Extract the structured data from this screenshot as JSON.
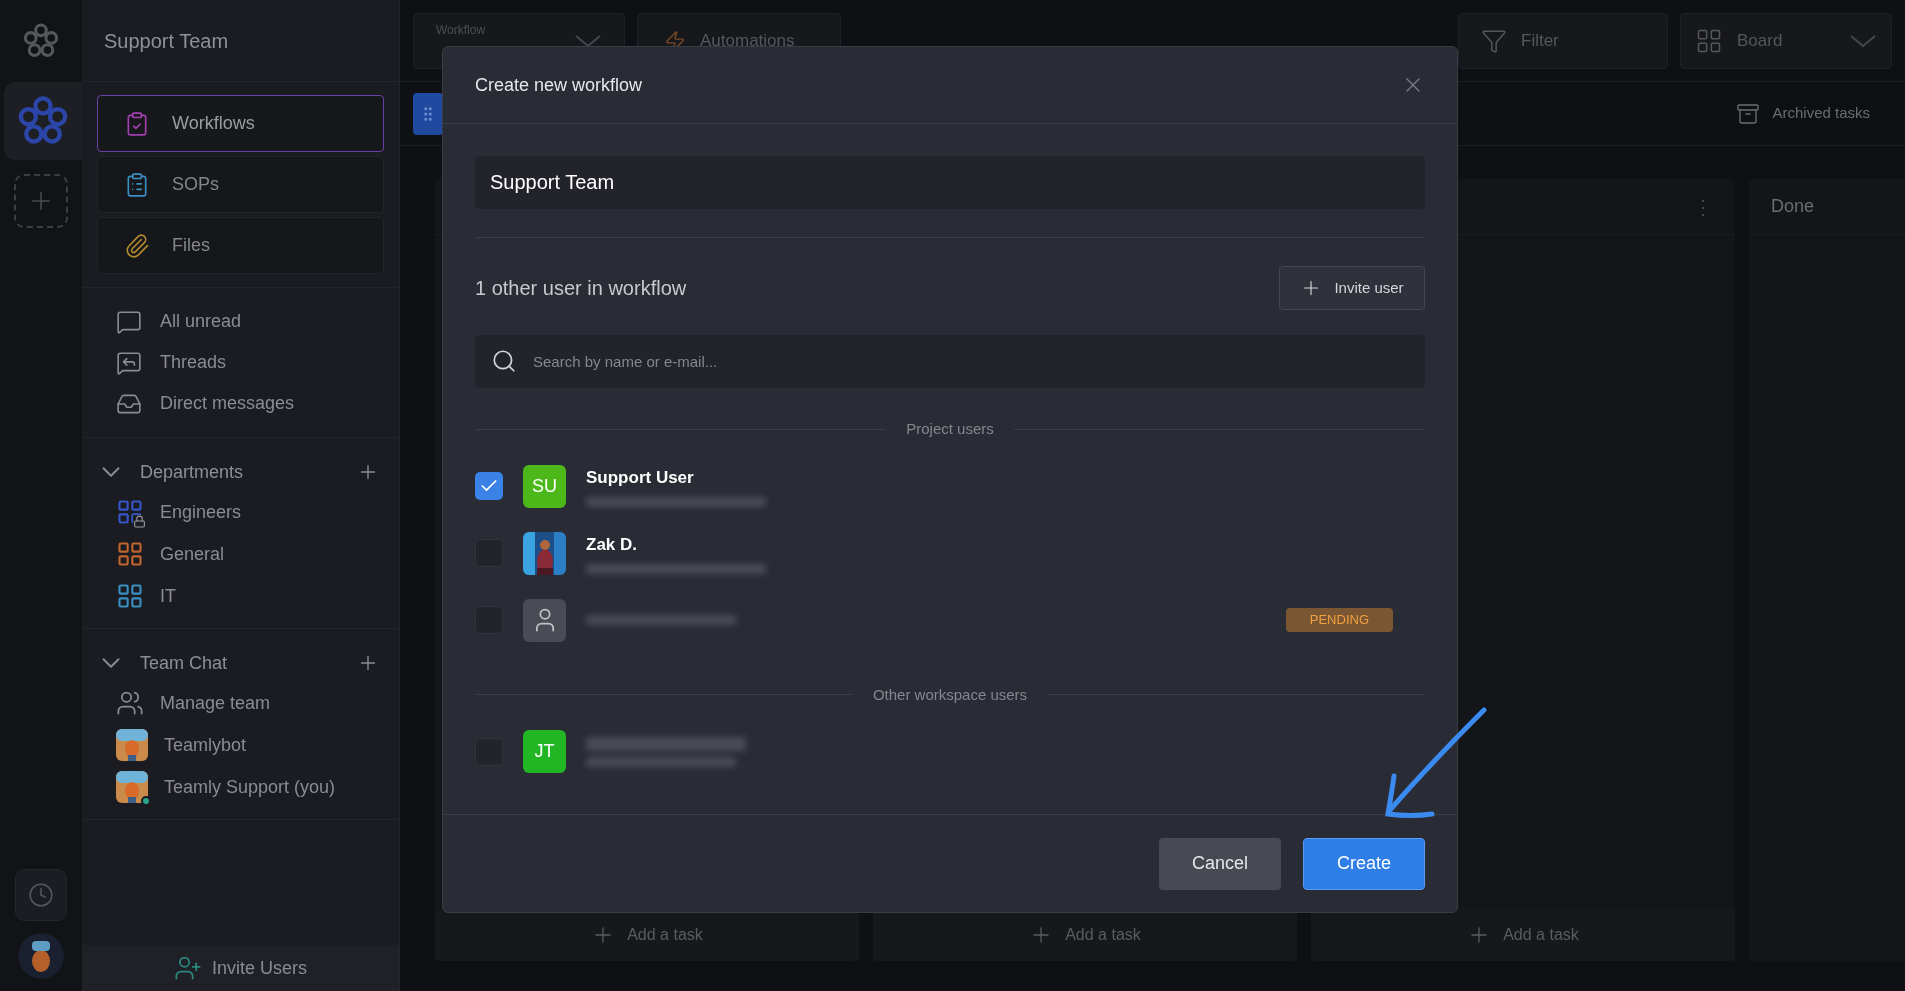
{
  "sidebar": {
    "title": "Support Team",
    "nav": [
      {
        "label": "Workflows",
        "selected": true
      },
      {
        "label": "SOPs",
        "selected": false
      },
      {
        "label": "Files",
        "selected": false
      }
    ],
    "links": [
      "All unread",
      "Threads",
      "Direct messages"
    ],
    "sections": [
      {
        "title": "Departments",
        "expanded": true,
        "items": [
          {
            "label": "Engineers",
            "color": "#3557c9",
            "locked": true
          },
          {
            "label": "General",
            "color": "#c2652f",
            "locked": false
          },
          {
            "label": "IT",
            "color": "#3a8fc4",
            "locked": false
          }
        ]
      },
      {
        "title": "Team Chat",
        "expanded": true,
        "items": [
          {
            "label": "Manage team",
            "kind": "action"
          },
          {
            "label": "Teamlybot",
            "kind": "bot"
          },
          {
            "label": "Teamly Support (you)",
            "kind": "user",
            "online": true
          }
        ]
      }
    ],
    "footer_button": "Invite Users"
  },
  "toolbar": {
    "workflow_select": {
      "label": "Workflow"
    },
    "automations": "Automations",
    "filter": "Filter",
    "view_select": "Board",
    "archived": "Archived tasks"
  },
  "columns": [
    {
      "add_label": "Add a task"
    },
    {
      "add_label": "Add a task"
    },
    {
      "menu": "⋮",
      "add_label": "Add a task"
    },
    {
      "title": "Done"
    }
  ],
  "modal": {
    "title": "Create new workflow",
    "name_value": "Support Team",
    "count_text": "1 other user in workflow",
    "invite_button": "Invite user",
    "search_placeholder": "Search by name or e-mail...",
    "groups": [
      {
        "title": "Project users",
        "users": [
          {
            "kind": "initials",
            "initials": "SU",
            "color": "#4cb81a",
            "name": "Support User",
            "checked": true
          },
          {
            "name": "Zak D.",
            "checked": false
          },
          {
            "kind": "placeholder",
            "checked": false,
            "badge": "PENDING"
          }
        ]
      },
      {
        "title": "Other workspace users",
        "users": [
          {
            "kind": "initials",
            "initials": "JT",
            "color": "#22b524",
            "checked": false
          }
        ]
      }
    ],
    "cancel": "Cancel",
    "create": "Create"
  }
}
